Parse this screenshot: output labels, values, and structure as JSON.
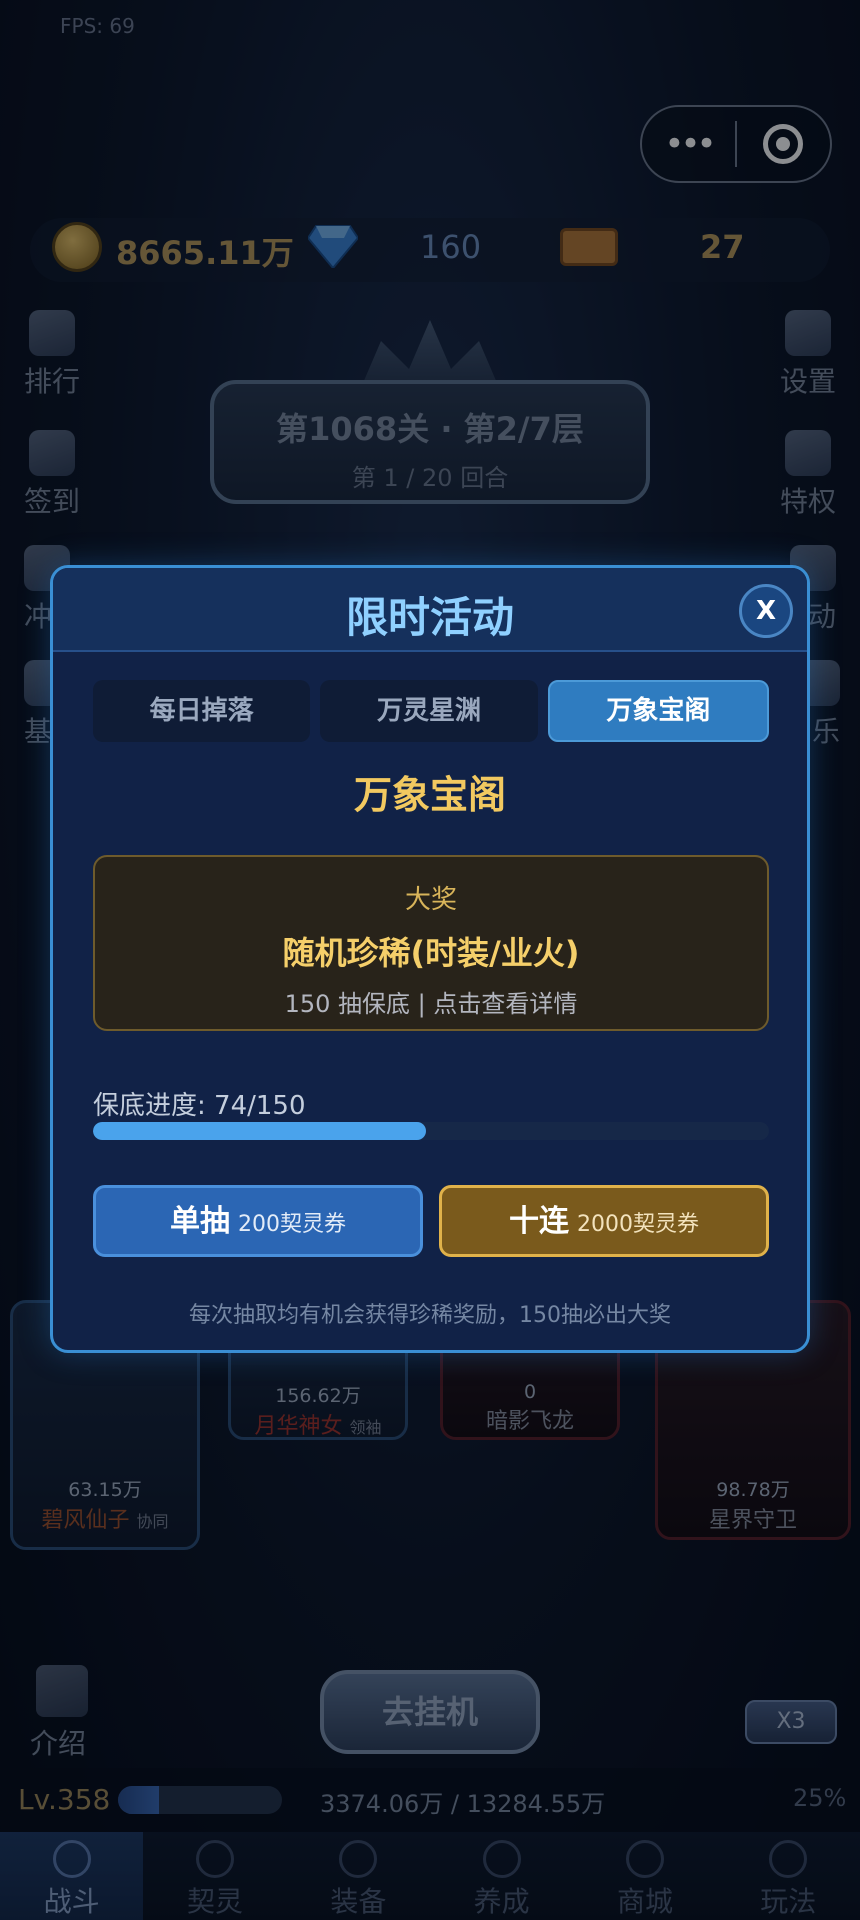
{
  "fps": "FPS: 69",
  "currency": {
    "gold": "8665.11万",
    "gems": "160",
    "tickets": "27"
  },
  "left_menu": [
    "排行",
    "签到",
    "冲",
    "基"
  ],
  "right_menu": [
    "设置",
    "特权",
    "动",
    "乐"
  ],
  "stage": {
    "title": "第1068关 · 第2/7层",
    "round": "第 1 / 20 回合"
  },
  "heroes": [
    {
      "power": "63.15万",
      "name": "碧风仙子",
      "tag": "协同"
    },
    {
      "power": "156.62万",
      "name": "月华神女",
      "tag": "领袖"
    },
    {
      "power": "0",
      "name": "暗影飞龙",
      "tag": ""
    },
    {
      "power": "98.78万",
      "name": "星界守卫",
      "tag": ""
    }
  ],
  "intro_label": "介绍",
  "idle_button": "去挂机",
  "speed_button": "X3",
  "level": {
    "label": "Lv.358",
    "xp": "3374.06万 / 13284.55万",
    "percent_text": "25%",
    "fill": 0.25
  },
  "nav": [
    {
      "label": "战斗",
      "active": true
    },
    {
      "label": "契灵",
      "active": false
    },
    {
      "label": "装备",
      "active": false
    },
    {
      "label": "养成",
      "active": false
    },
    {
      "label": "商城",
      "active": false
    },
    {
      "label": "玩法",
      "active": false
    }
  ],
  "modal": {
    "title": "限时活动",
    "close": "X",
    "tabs": [
      {
        "label": "每日掉落",
        "active": false
      },
      {
        "label": "万灵星渊",
        "active": false
      },
      {
        "label": "万象宝阁",
        "active": true
      }
    ],
    "section_title": "万象宝阁",
    "prize": {
      "label": "大奖",
      "name": "随机珍稀(时装/业火)",
      "sub": "150 抽保底 | 点击查看详情"
    },
    "progress": {
      "label": "保底进度: 74/150",
      "value": 74,
      "max": 150
    },
    "single": {
      "label": "单抽",
      "cost": "200契灵券"
    },
    "ten": {
      "label": "十连",
      "cost": "2000契灵券"
    },
    "note": "每次抽取均有机会获得珍稀奖励，150抽必出大奖"
  },
  "colors": {
    "accent": "#4aa3ec",
    "gold": "#f2c960",
    "modal_bg": "#112247"
  }
}
